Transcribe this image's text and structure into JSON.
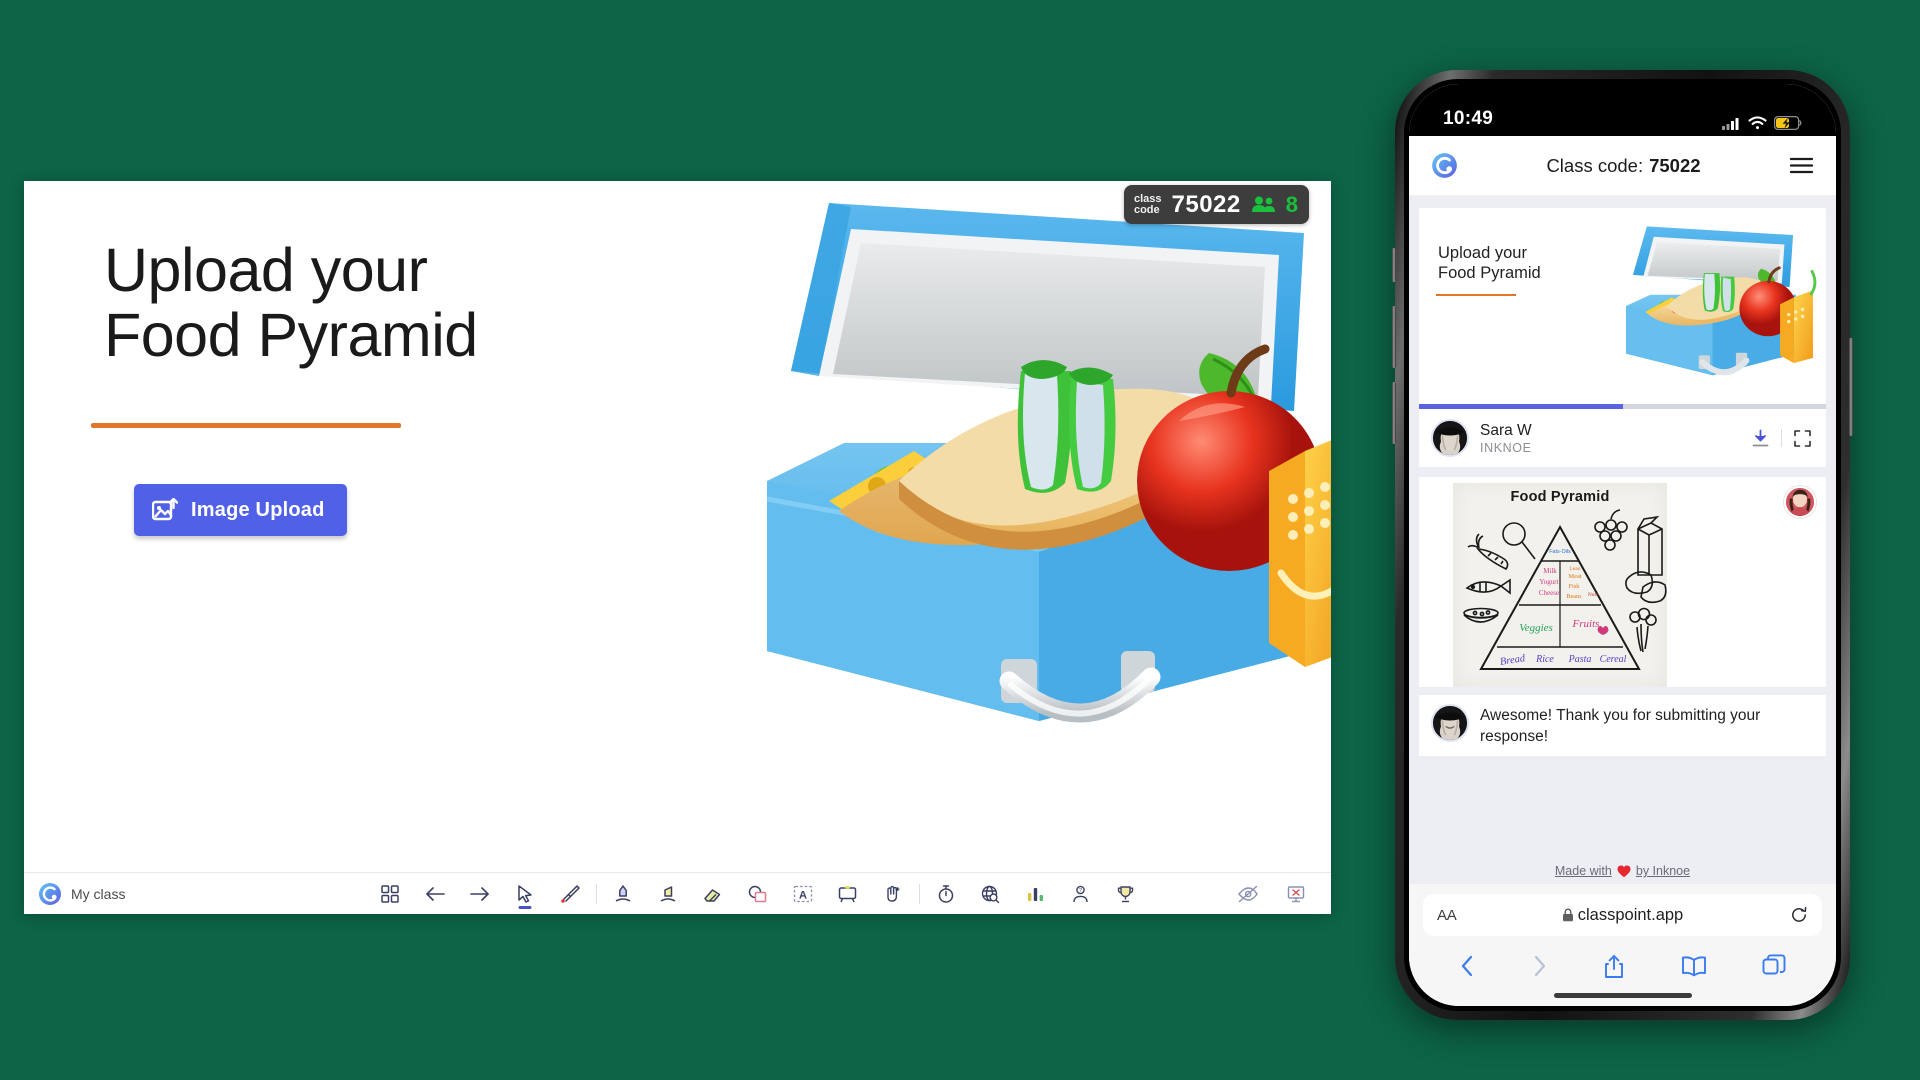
{
  "background_color": "#0d6447",
  "slide": {
    "title": "Upload your\nFood Pyramid",
    "upload_button_label": "Image Upload",
    "accent_rule_color": "#e2762a",
    "button_color": "#5061e8",
    "illustration": "lunchbox-with-sandwich-apple-juice",
    "badge": {
      "class_code_label": "class\ncode",
      "class_code_value": "75022",
      "participant_count": "8",
      "participant_icon": "people-icon",
      "count_color": "#19c13c"
    }
  },
  "toolbar": {
    "brand_icon": "classpoint-logo-icon",
    "class_name": "My class",
    "center_tools": [
      {
        "name": "slide-grid-icon",
        "label": "Slide overview"
      },
      {
        "name": "arrow-left-icon",
        "label": "Previous slide"
      },
      {
        "name": "arrow-right-icon",
        "label": "Next slide"
      },
      {
        "name": "cursor-pointer-icon",
        "label": "Pointer",
        "active": true
      },
      {
        "name": "laser-pointer-icon",
        "label": "Laser pointer"
      },
      {
        "name": "pen-icon",
        "label": "Pen"
      },
      {
        "name": "highlighter-icon",
        "label": "Highlighter"
      },
      {
        "name": "eraser-icon",
        "label": "Eraser"
      },
      {
        "name": "shapes-icon",
        "label": "Shapes"
      },
      {
        "name": "text-box-icon",
        "label": "Text box"
      },
      {
        "name": "whiteboard-icon",
        "label": "Whiteboard"
      },
      {
        "name": "drag-objects-icon",
        "label": "Draggable objects"
      },
      {
        "name": "timer-icon",
        "label": "Timer"
      },
      {
        "name": "browser-icon",
        "label": "Embedded browser"
      },
      {
        "name": "poll-bar-icon",
        "label": "Quick poll"
      },
      {
        "name": "pick-name-icon",
        "label": "Pick name"
      },
      {
        "name": "leaderboard-icon",
        "label": "Leaderboard"
      }
    ],
    "right_tools": [
      {
        "name": "hide-annotation-icon",
        "label": "Hide annotations"
      },
      {
        "name": "exit-slideshow-icon",
        "label": "Exit slideshow"
      }
    ]
  },
  "phone": {
    "status_bar": {
      "time": "10:49",
      "signal_icon": "cellular-signal-icon",
      "wifi_icon": "wifi-icon",
      "battery_icon": "battery-charging-icon",
      "battery_color": "#f5c518"
    },
    "app_header": {
      "logo_icon": "classpoint-logo-icon",
      "class_code_label": "Class code:",
      "class_code_value": "75022",
      "menu_icon": "hamburger-menu-icon"
    },
    "mini_slide": {
      "title": "Upload your\nFood Pyramid",
      "rule_color": "#e2762a",
      "illustration": "lunchbox-with-sandwich-apple-juice"
    },
    "progress": {
      "percent": 50,
      "fill_color": "#5a64e0"
    },
    "response": {
      "avatar_icon": "user-avatar",
      "name": "Sara W",
      "organization": "INKNOE",
      "download_icon": "download-icon",
      "expand_icon": "expand-fullscreen-icon"
    },
    "submission": {
      "paper_title": "Food Pyramid",
      "student_avatar_icon": "student-avatar",
      "pyramid_labels": {
        "tier1": "Fats · Oils",
        "tier2_left": "Milk\nYogurt\nCheese",
        "tier2_right": "Meat\nFish\nBeans\nNuts",
        "tier3_left": "Veggies",
        "tier3_right": "Fruits",
        "tier4": [
          "Bread",
          "Rice",
          "Pasta",
          "Cereal"
        ]
      },
      "side_doodles": [
        "lollipop",
        "carrot",
        "fish",
        "beans-bowl",
        "grapes",
        "milk-carton",
        "bread-loaf",
        "broccoli"
      ]
    },
    "comment": {
      "avatar_icon": "teacher-avatar",
      "text": "Awesome! Thank you for submitting your response!"
    },
    "footer": {
      "made_with_prefix": "Made with",
      "heart_icon": "heart-icon",
      "made_with_suffix": "by Inknoe"
    },
    "safari": {
      "text_size_label": "AA",
      "lock_icon": "lock-icon",
      "url": "classpoint.app",
      "reload_icon": "reload-icon",
      "back_icon": "chevron-left-icon",
      "forward_icon": "chevron-right-icon",
      "share_icon": "share-icon",
      "bookmarks_icon": "book-icon",
      "tabs_icon": "tabs-icon"
    }
  }
}
